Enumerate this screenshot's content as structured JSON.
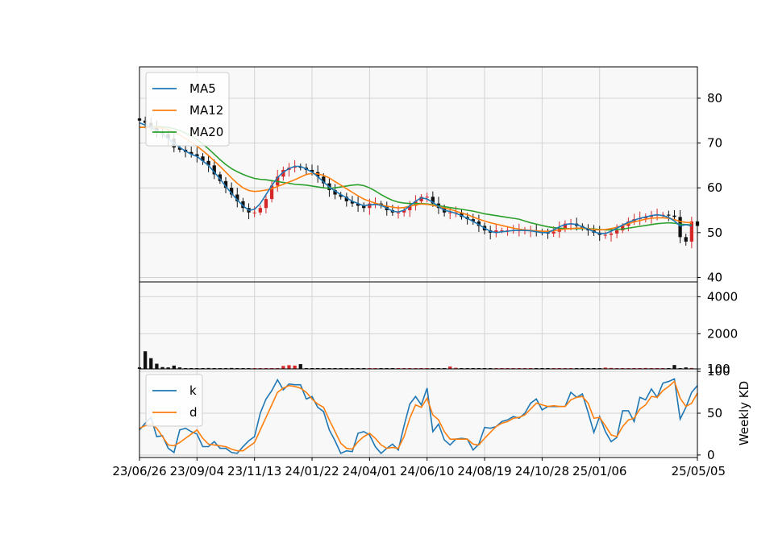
{
  "chart_data": {
    "type": "candlestick",
    "x_tick_labels": [
      "23/06/26",
      "23/09/04",
      "23/11/13",
      "24/01/22",
      "24/04/01",
      "24/06/10",
      "24/08/19",
      "24/10/28",
      "25/01/06",
      "25/05/05"
    ],
    "x_tick_weeks": [
      0,
      10,
      20,
      30,
      40,
      50,
      60,
      70,
      80,
      97
    ],
    "price_panel": {
      "ylim": [
        39,
        87
      ],
      "yticks": [
        40,
        50,
        60,
        70,
        80
      ],
      "legend": [
        "MA5",
        "MA12",
        "MA20"
      ],
      "legend_position": "upper-left",
      "colors": {
        "up": "#d62728",
        "down": "#111111",
        "ma5": "#1f77b4",
        "ma12": "#ff7f0e",
        "ma20": "#2ca02c"
      },
      "close": [
        75,
        74.5,
        73.5,
        72.5,
        72,
        71,
        69,
        68.5,
        68,
        67.5,
        67,
        66,
        65,
        63,
        61.5,
        60,
        58.5,
        57,
        55.5,
        54.5,
        54.5,
        55.5,
        57.5,
        60.5,
        62.5,
        64,
        64.5,
        64.8,
        64.5,
        64,
        63.5,
        62.5,
        61,
        59.5,
        58.5,
        58,
        57,
        56.5,
        56,
        55.5,
        56.5,
        56.5,
        56,
        55,
        54.5,
        54.5,
        55,
        56,
        57,
        58,
        58,
        56.5,
        55.5,
        54.5,
        54.5,
        54.5,
        53.5,
        53,
        52.5,
        51.5,
        50.5,
        50,
        50.5,
        50.5,
        50.5,
        50.5,
        50.5,
        50.5,
        50.5,
        50.2,
        50,
        49.8,
        50.2,
        51,
        52,
        52,
        51.5,
        51,
        50.5,
        50,
        49.5,
        49.5,
        49.8,
        50.5,
        51.5,
        52.5,
        53,
        53.2,
        53.5,
        53.8,
        54,
        54,
        53.8,
        53.5,
        49,
        48,
        52.5,
        51.5
      ],
      "ma5": [
        74.5,
        74,
        73.5,
        72.8,
        72,
        71,
        70,
        69,
        68.2,
        67.5,
        67,
        66,
        65,
        63.5,
        62,
        60.3,
        58.8,
        57.3,
        56,
        55,
        55.2,
        56.5,
        58.5,
        60.5,
        62.3,
        63.5,
        64.3,
        64.8,
        64.8,
        64.2,
        63.5,
        62.5,
        61.3,
        60.2,
        59.3,
        58.5,
        57.8,
        57,
        56.5,
        56,
        56.2,
        56.3,
        56.1,
        55.5,
        54.8,
        54.6,
        55,
        56,
        57,
        57.8,
        57.5,
        56.8,
        55.8,
        55,
        54.7,
        54.3,
        53.8,
        53.2,
        52.5,
        51.8,
        51,
        50.3,
        50,
        50.2,
        50.3,
        50.5,
        50.5,
        50.5,
        50.4,
        50.2,
        50,
        50,
        50.6,
        51.3,
        51.8,
        52,
        51.8,
        51.3,
        50.8,
        50.2,
        49.8,
        49.8,
        50.3,
        51,
        51.7,
        52.3,
        52.8,
        53.2,
        53.5,
        53.8,
        54,
        53.8,
        53.4,
        52.6,
        51.5,
        51.8,
        51.5
      ],
      "ma12": [
        73.5,
        73.5,
        73.5,
        73.5,
        73.3,
        73,
        72.5,
        71.8,
        71,
        70.2,
        69.3,
        68.3,
        67.2,
        66,
        64.8,
        63.5,
        62.2,
        61,
        60,
        59.4,
        59.2,
        59.3,
        59.5,
        59.8,
        60.3,
        60.8,
        61.3,
        61.8,
        62.4,
        63,
        63.2,
        63.1,
        62.8,
        62.2,
        61.4,
        60.6,
        59.8,
        59,
        58.2,
        57.5,
        57,
        56.6,
        56.2,
        55.9,
        55.7,
        55.5,
        55.6,
        55.9,
        56.2,
        56.4,
        56.3,
        56.1,
        55.8,
        55.5,
        55.2,
        54.8,
        54.4,
        54,
        53.5,
        53,
        52.6,
        52.2,
        51.9,
        51.6,
        51.3,
        51,
        50.8,
        50.6,
        50.5,
        50.4,
        50.3,
        50.3,
        50.4,
        50.6,
        50.8,
        50.9,
        51,
        51,
        50.9,
        50.7,
        50.6,
        50.7,
        50.9,
        51.2,
        51.6,
        52,
        52.4,
        52.7,
        53,
        53.2,
        53.3,
        53.3,
        53.2,
        52.9,
        52.5,
        52.3,
        52.2
      ],
      "ma20": [
        73.5,
        73.5,
        73.6,
        73.7,
        73.6,
        73.5,
        73.2,
        72.8,
        72.2,
        71.6,
        70.8,
        69.8,
        68.7,
        67.5,
        66.3,
        65.2,
        64.3,
        63.6,
        63,
        62.5,
        62.1,
        61.9,
        61.8,
        61.6,
        61.4,
        61.2,
        61,
        60.8,
        60.7,
        60.6,
        60.4,
        60.2,
        60,
        59.9,
        60,
        60.2,
        60.4,
        60.6,
        60.7,
        60.5,
        60,
        59.3,
        58.5,
        57.8,
        57.2,
        56.8,
        56.6,
        56.5,
        56.5,
        56.5,
        56.4,
        56.2,
        56,
        55.8,
        55.6,
        55.4,
        55.2,
        55,
        54.8,
        54.5,
        54.2,
        54,
        53.8,
        53.6,
        53.4,
        53.2,
        53,
        52.6,
        52.2,
        51.9,
        51.6,
        51.3,
        51.1,
        51,
        50.9,
        50.9,
        50.9,
        50.9,
        50.9,
        50.8,
        50.7,
        50.6,
        50.6,
        50.7,
        50.8,
        51,
        51.2,
        51.4,
        51.6,
        51.8,
        52,
        52.1,
        52.2,
        52.1,
        51.9,
        51.8,
        51.7
      ]
    },
    "volume_panel": {
      "ylim": [
        100,
        4800
      ],
      "yticks": [
        100,
        2000,
        4000
      ],
      "volume": [
        180,
        1050,
        680,
        380,
        200,
        180,
        280,
        180,
        120,
        100,
        120,
        130,
        150,
        110,
        110,
        130,
        150,
        110,
        120,
        110,
        100,
        100,
        130,
        120,
        140,
        260,
        300,
        280,
        360,
        120,
        110,
        100,
        110,
        100,
        110,
        120,
        100,
        110,
        100,
        120,
        110,
        130,
        110,
        120,
        100,
        100,
        110,
        110,
        120,
        140,
        120,
        130,
        110,
        120,
        230,
        160,
        110,
        120,
        120,
        110,
        100,
        110,
        100,
        110,
        100,
        110,
        100,
        120,
        100,
        110,
        100,
        120,
        110,
        110,
        120,
        100,
        130,
        120,
        110,
        100,
        110,
        170,
        150,
        120,
        110,
        120,
        120,
        140,
        150,
        130,
        120,
        110,
        130,
        310,
        120,
        180,
        150
      ]
    },
    "kd_panel": {
      "ylabel": "Weekly KD",
      "ylim": [
        -3,
        103
      ],
      "yticks": [
        0,
        50,
        100
      ],
      "legend": [
        "k",
        "d"
      ],
      "k": [
        30,
        38,
        45,
        22,
        23,
        8,
        3,
        30,
        32,
        28,
        25,
        10,
        10,
        16,
        8,
        8,
        3,
        2,
        10,
        17,
        22,
        50,
        67,
        77,
        90,
        78,
        85,
        84,
        84,
        67,
        70,
        57,
        52,
        30,
        17,
        2,
        5,
        4,
        26,
        28,
        24,
        10,
        2,
        8,
        13,
        6,
        35,
        61,
        70,
        60,
        80,
        28,
        37,
        18,
        12,
        19,
        20,
        19,
        6,
        13,
        33,
        32,
        34,
        40,
        42,
        46,
        44,
        50,
        62,
        67,
        54,
        58,
        58,
        58,
        58,
        75,
        69,
        73,
        51,
        27,
        46,
        28,
        16,
        21,
        53,
        53,
        40,
        69,
        66,
        79,
        69,
        86,
        88,
        91,
        43,
        57,
        75,
        83
      ],
      "d": [
        32,
        35,
        37,
        32,
        22,
        12,
        11,
        15,
        20,
        25,
        30,
        20,
        13,
        12,
        11,
        10,
        7,
        5,
        5,
        10,
        15,
        30,
        45,
        60,
        75,
        80,
        83,
        82,
        80,
        75,
        67,
        61,
        57,
        42,
        28,
        14,
        8,
        7,
        16,
        22,
        26,
        20,
        12,
        8,
        9,
        8,
        22,
        44,
        60,
        57,
        68,
        48,
        42,
        28,
        19,
        19,
        19,
        19,
        13,
        12,
        20,
        27,
        34,
        38,
        40,
        44,
        45,
        48,
        55,
        62,
        60,
        58,
        59,
        58,
        58,
        66,
        69,
        70,
        62,
        44,
        45,
        35,
        24,
        22,
        34,
        42,
        44,
        55,
        60,
        70,
        69,
        77,
        82,
        88,
        68,
        58,
        62,
        74
      ]
    }
  }
}
